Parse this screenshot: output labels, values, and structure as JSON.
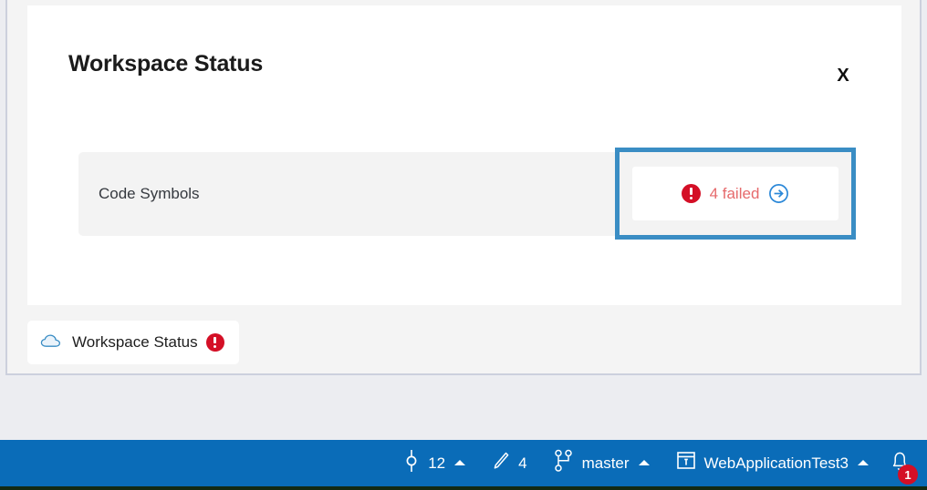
{
  "panel": {
    "title": "Workspace Status",
    "close_label": "X",
    "rows": [
      {
        "label": "Code Symbols",
        "status_text": "4 failed",
        "status_icon": "error-circle-icon",
        "go_icon": "arrow-right-circle-icon",
        "highlighted": true
      }
    ]
  },
  "dock_tab": {
    "icon": "cloud-icon",
    "label": "Workspace Status",
    "badge_icon": "error-circle-icon"
  },
  "statusbar": {
    "items": [
      {
        "icon": "pending-changes-icon",
        "label": "12",
        "caret": "caret-up-icon"
      },
      {
        "icon": "pencil-edit-icon",
        "label": "4",
        "caret": ""
      },
      {
        "icon": "source-branch-icon",
        "label": "master",
        "caret": "caret-up-icon"
      },
      {
        "icon": "repository-icon",
        "label": "WebApplicationTest3",
        "caret": "caret-up-icon"
      }
    ],
    "notifications": {
      "icon": "bell-icon",
      "count": "1"
    }
  },
  "colors": {
    "statusbar_blue": "#0a6cb8",
    "highlight_blue": "#3a8dc4",
    "error_red": "#d40f26",
    "fail_text": "#e66a6c",
    "link_blue": "#2b88d8",
    "panel_bg": "#f4f4f4",
    "row_bg": "#f3f3f3"
  }
}
